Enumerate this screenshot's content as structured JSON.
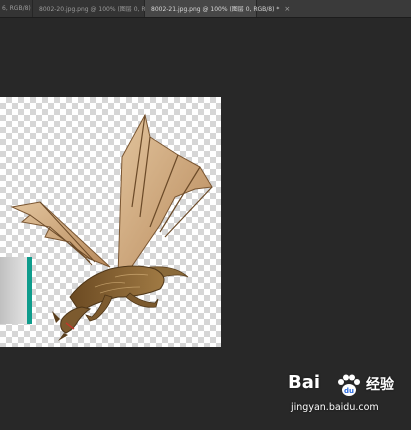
{
  "tabs": [
    {
      "label": "6, RGB/8)",
      "active": false
    },
    {
      "label": "8002-20.jpg.png @ 100% (图层 0, RGB/8)",
      "active": false
    },
    {
      "label": "8002-21.jpg.png @ 100% (图层 0, RGB/8) *",
      "active": true
    }
  ],
  "close_glyph": "×",
  "icons": {
    "tab_close": "close-icon",
    "watermark_paw": "paw-icon"
  },
  "colors": {
    "workspace": "#282828",
    "tabbar": "#3a3a3a",
    "accent_bar": "#0f9c8c",
    "dragon_wing": "#c9a27a",
    "dragon_body": "#8a6a3a"
  },
  "watermark": {
    "brand": "Bai",
    "brand_suffix": "经验",
    "url": "jingyan.baidu.com"
  }
}
